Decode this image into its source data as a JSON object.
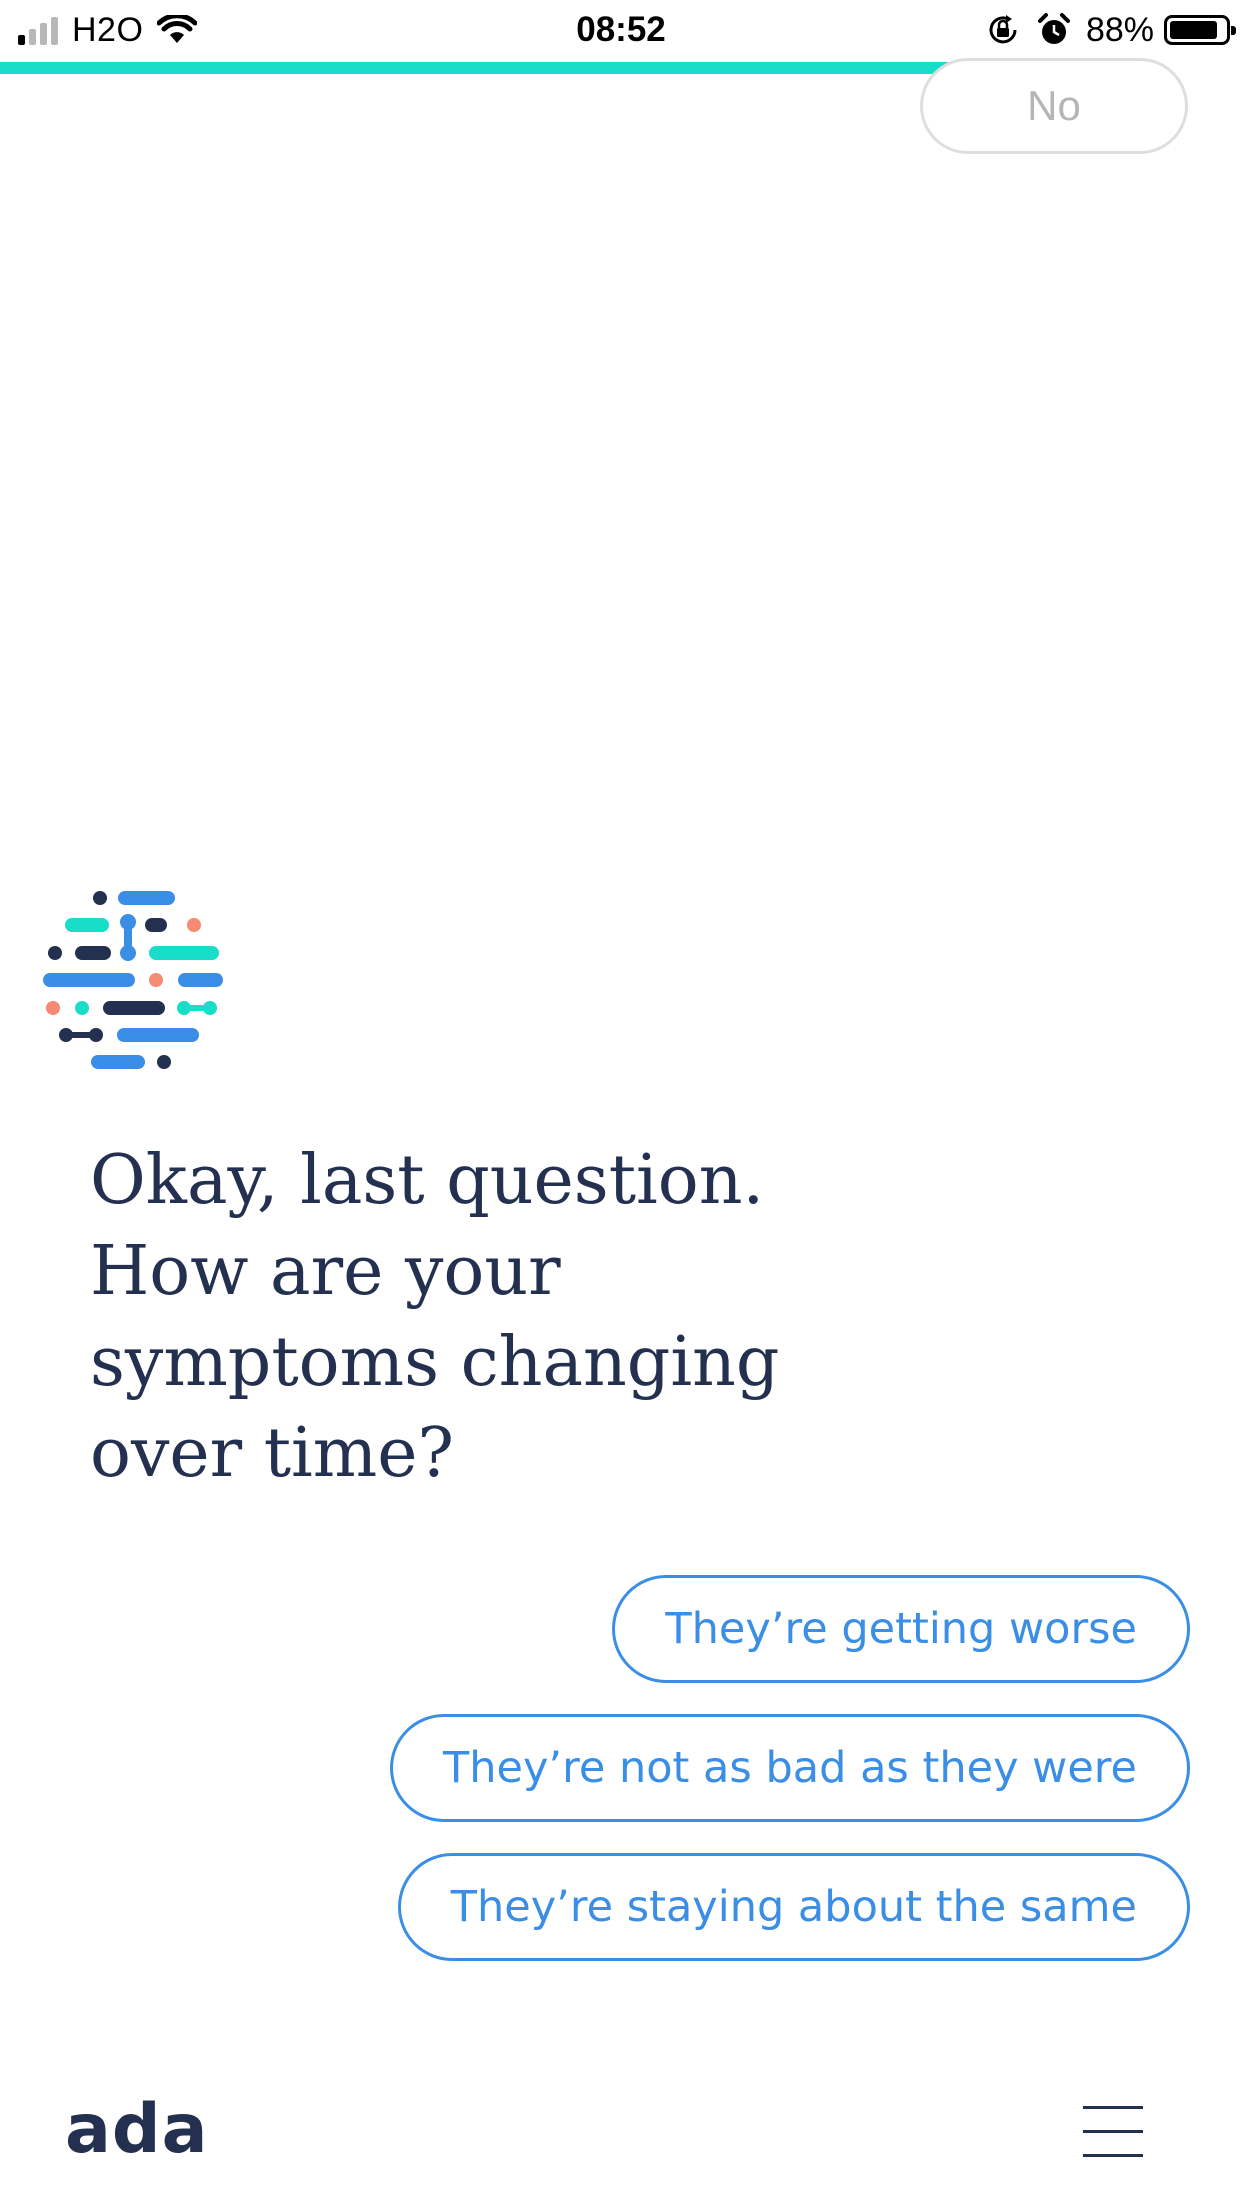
{
  "status_bar": {
    "carrier": "H2O",
    "time": "08:52",
    "battery_percent": "88%",
    "battery_level": 0.88,
    "signal_bars_active": 1,
    "signal_bars_total": 4,
    "icons": [
      "signal-icon",
      "wifi-icon",
      "rotation-lock-icon",
      "alarm-icon",
      "battery-icon"
    ]
  },
  "progress": {
    "fraction": 0.865,
    "color": "#17ddc9"
  },
  "previous_answer": {
    "label": "No"
  },
  "question": {
    "lines": [
      "Okay, last question.",
      "How are your",
      "symptoms changing",
      "over time?"
    ]
  },
  "options": [
    "They’re getting worse",
    "They’re not as bad as they were",
    "They’re staying about the same"
  ],
  "footer": {
    "brand": "ada",
    "menu_icon": "hamburger-menu-icon"
  },
  "colors": {
    "navy": "#23304f",
    "blue": "#3a8ee6",
    "teal": "#17ddc9",
    "coral": "#f48b72"
  }
}
